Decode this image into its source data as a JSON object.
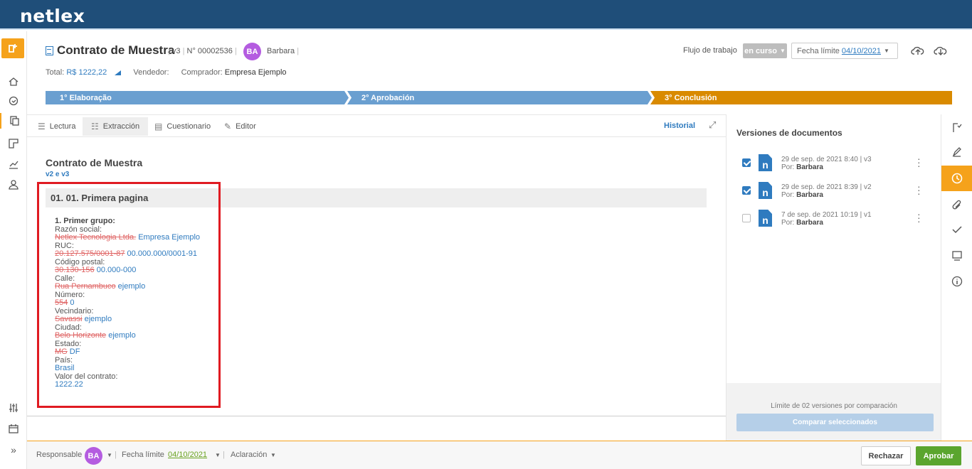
{
  "app": {
    "logo": "netlex"
  },
  "document": {
    "title": "Contrato de Muestra",
    "version": "v3",
    "number": "N° 00002536",
    "owner_initials": "BA",
    "owner_name": "Barbara",
    "total_label": "Total:",
    "total_value": "R$ 1222,22",
    "seller_label": "Vendedor:",
    "buyer_label": "Comprador:",
    "buyer_value": "Empresa Ejemplo"
  },
  "workflow": {
    "label": "Flujo de trabajo",
    "status": "en curso",
    "due_label": "Fecha límite",
    "due_value": "04/10/2021"
  },
  "stages": [
    {
      "label": "1° Elaboração",
      "color": "#6a9fd0"
    },
    {
      "label": "2° Aprobación",
      "color": "#6a9fd0"
    },
    {
      "label": "3° Conclusión",
      "color": "#d98a00"
    }
  ],
  "tabs": [
    {
      "label": "Lectura",
      "icon": "lines-icon"
    },
    {
      "label": "Extracción",
      "icon": "extract-icon"
    },
    {
      "label": "Cuestionario",
      "icon": "form-icon"
    },
    {
      "label": "Editor",
      "icon": "edit-icon"
    }
  ],
  "historial_label": "Historial",
  "content": {
    "title": "Contrato de Muestra",
    "compare": "v2 e v3",
    "section": "01. 01. Primera pagina",
    "group": "1. Primer grupo:",
    "fields": [
      {
        "label": "Razón social:",
        "old": "Netlex Tecnologia Ltda.",
        "new": "Empresa Ejemplo"
      },
      {
        "label": "RUC:",
        "old": "20.127.575/0001-87",
        "new": "00.000.000/0001-91"
      },
      {
        "label": "Código postal:",
        "old": "30.130-156",
        "new": "00.000-000"
      },
      {
        "label": "Calle:",
        "old": "Rua Pernambuco",
        "new": "ejemplo"
      },
      {
        "label": "Número:",
        "old": "554",
        "new": "0"
      },
      {
        "label": "Vecindario:",
        "old": "Savassi",
        "new": "ejemplo"
      },
      {
        "label": "Ciudad:",
        "old": "Belo Horizonte",
        "new": "ejemplo"
      },
      {
        "label": "Estado:",
        "old": "MG",
        "new": "DF"
      },
      {
        "label": "País:",
        "old": "",
        "new": "Brasil"
      },
      {
        "label": "Valor del contrato:",
        "old": "",
        "new": "1222.22"
      }
    ]
  },
  "versions_panel": {
    "title": "Versiones de documentos",
    "by_label": "Por:",
    "versions": [
      {
        "date": "29 de sep. de 2021 8:40 | v3",
        "author": "Barbara",
        "checked": true
      },
      {
        "date": "29 de sep. de 2021 8:39 | v2",
        "author": "Barbara",
        "checked": true
      },
      {
        "date": "7 de sep. de 2021 10:19 | v1",
        "author": "Barbara",
        "checked": false
      }
    ],
    "limit_text": "Límite de 02 versiones por comparación",
    "compare_button": "Comparar seleccionados"
  },
  "footer": {
    "responsible_label": "Responsable",
    "responsible_initials": "BA",
    "due_label": "Fecha límite",
    "due_value": "04/10/2021",
    "clarification_label": "Aclaración",
    "reject_button": "Rechazar",
    "approve_button": "Aprobar"
  }
}
